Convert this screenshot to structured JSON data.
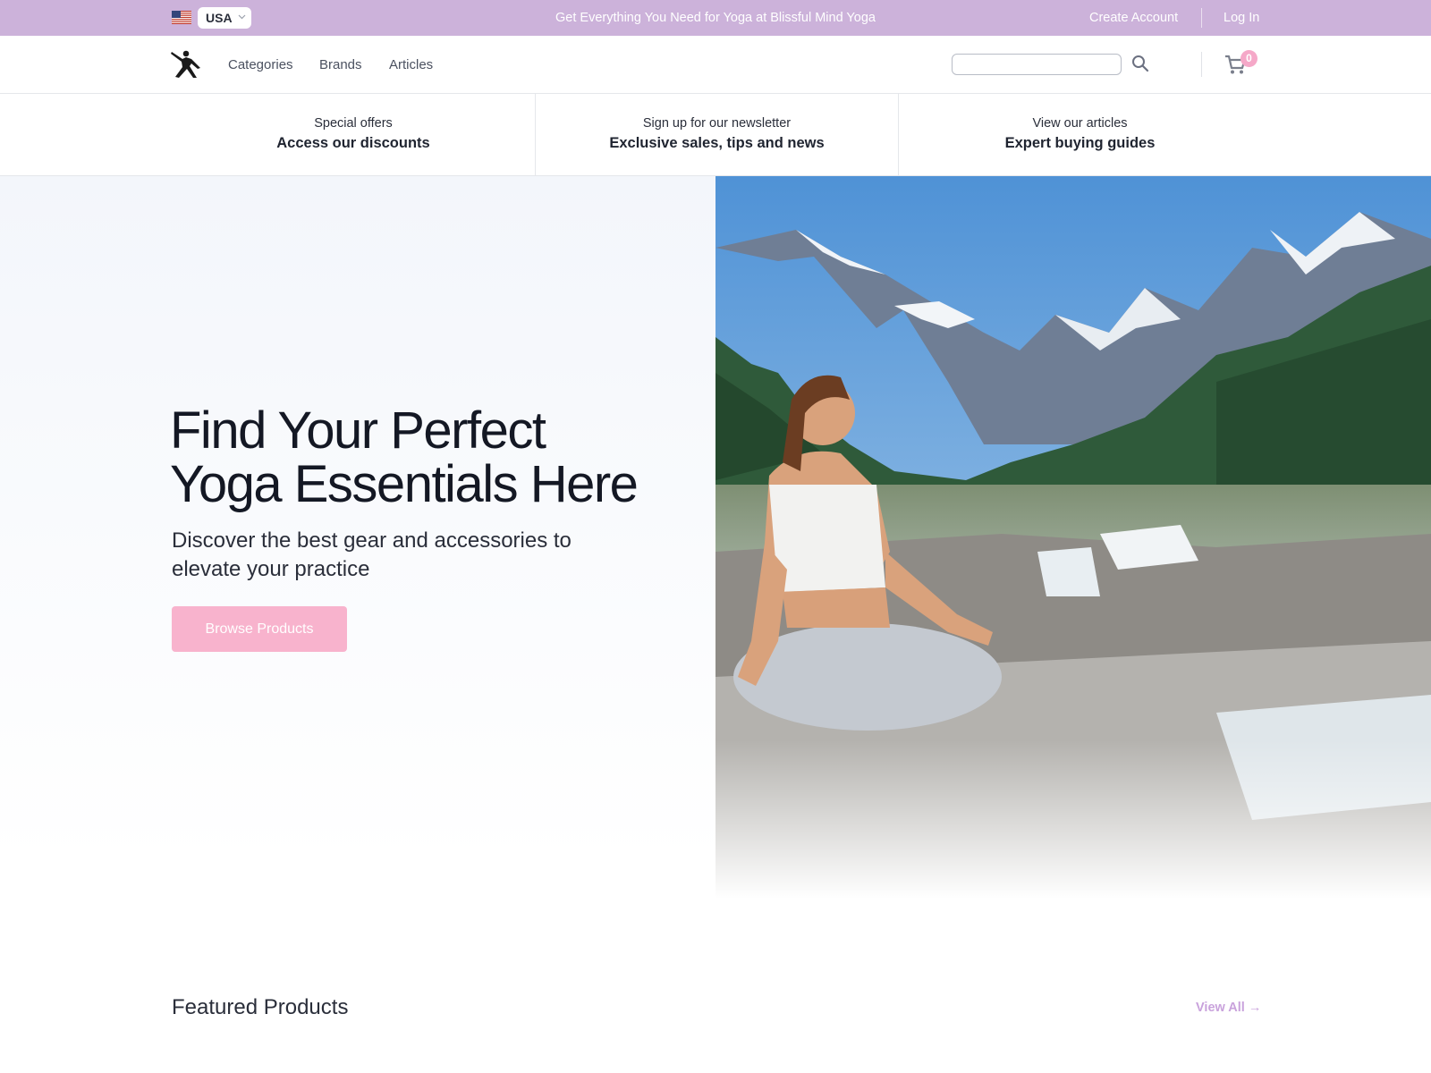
{
  "topbar": {
    "country": "USA",
    "announcement": "Get Everything You Need for Yoga at Blissful Mind Yoga",
    "create_account": "Create Account",
    "log_in": "Log In"
  },
  "header": {
    "nav": [
      "Categories",
      "Brands",
      "Articles"
    ],
    "search_placeholder": "",
    "cart_count": "0"
  },
  "strip": [
    {
      "small": "Special offers",
      "big": "Access our discounts"
    },
    {
      "small": "Sign up for our newsletter",
      "big": "Exclusive sales, tips and news"
    },
    {
      "small": "View our articles",
      "big": "Expert buying guides"
    }
  ],
  "hero": {
    "title_line1": "Find Your Perfect",
    "title_line2": "Yoga Essentials Here",
    "subtitle_line1": "Discover the best gear and accessories to",
    "subtitle_line2": "elevate your practice",
    "button": "Browse Products"
  },
  "featured": {
    "title": "Featured Products",
    "view_all": "View All →"
  },
  "colors": {
    "topbar": "#ccb2da",
    "accent_pink": "#f8b3cd",
    "accent_lilac": "#c9a2dc"
  },
  "icons": [
    "us-flag-icon",
    "chevron-down-icon",
    "yoga-logo-icon",
    "search-icon",
    "cart-icon"
  ]
}
